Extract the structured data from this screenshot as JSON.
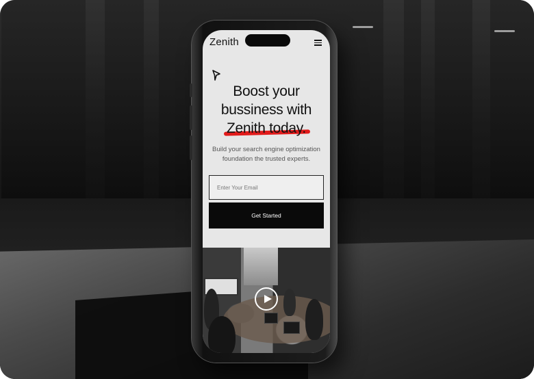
{
  "app": {
    "logo": "Zenith"
  },
  "hero": {
    "headline_line1": "Boost your",
    "headline_line2": "bussiness with",
    "headline_highlight": "Zenith today.",
    "subtitle": "Build your search engine optimization foundation the trusted experts."
  },
  "form": {
    "email_placeholder": "Enter Your Email",
    "cta_label": "Get Started"
  },
  "colors": {
    "highlight": "#e11b1b",
    "button_bg": "#0a0a0a",
    "screen_bg": "#e7e7e7"
  },
  "icons": {
    "menu": "hamburger-menu-icon",
    "spark": "sparkle-icon",
    "play": "play-icon"
  }
}
